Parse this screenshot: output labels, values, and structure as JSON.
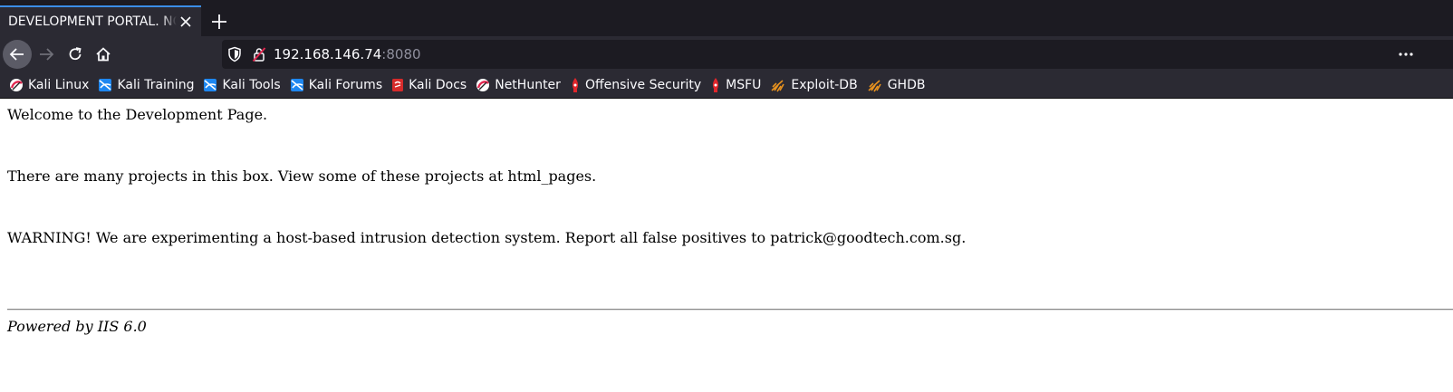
{
  "browser": {
    "tab": {
      "title": "DEVELOPMENT PORTAL. NOT FOR OUTSIDERS OR HACKERS!"
    },
    "urlbar": {
      "host": "192.168.146.74",
      "port": ":8080"
    },
    "bookmarks": [
      {
        "label": "Kali Linux",
        "icon": "kali-dragon-icon"
      },
      {
        "label": "Kali Training",
        "icon": "kali-training-icon"
      },
      {
        "label": "Kali Tools",
        "icon": "kali-tools-icon"
      },
      {
        "label": "Kali Forums",
        "icon": "kali-forums-icon"
      },
      {
        "label": "Kali Docs",
        "icon": "kali-docs-icon"
      },
      {
        "label": "NetHunter",
        "icon": "nethunter-icon"
      },
      {
        "label": "Offensive Security",
        "icon": "offsec-icon"
      },
      {
        "label": "MSFU",
        "icon": "msfu-icon"
      },
      {
        "label": "Exploit-DB",
        "icon": "exploit-db-icon"
      },
      {
        "label": "GHDB",
        "icon": "ghdb-icon"
      }
    ]
  },
  "page": {
    "welcome": "Welcome to the Development Page.",
    "projects": "There are many projects in this box. View some of these projects at html_pages.",
    "warning": "WARNING! We are experimenting a host-based intrusion detection system. Report all false positives to patrick@goodtech.com.sg.",
    "footer": "Powered by IIS 6.0"
  },
  "colors": {
    "tab_active": "#2b2a33",
    "toolbar": "#2b2a33",
    "frame": "#1c1b22",
    "accent": "#3b8ee8"
  }
}
